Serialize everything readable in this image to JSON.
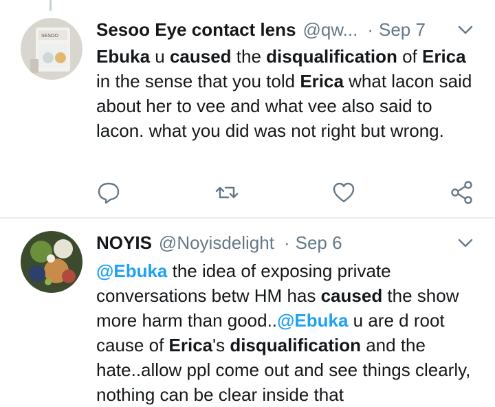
{
  "tweets": [
    {
      "name": "Sesoo Eye contact lens",
      "handle": "@qw...",
      "separator": "·",
      "date": "Sep 7",
      "body": {
        "t1": "Ebuka",
        "t2": " u ",
        "t3": "caused",
        "t4": " the ",
        "t5": "disqualification",
        "t6": " of ",
        "t7": "Erica",
        "t8": " in the sense that you told ",
        "t9": "Erica",
        "t10": " what lacon said about her to vee and what vee also said to lacon. what you did was not right but wrong."
      },
      "actions": [
        "reply-icon",
        "retweet-icon",
        "like-icon",
        "share-icon"
      ]
    },
    {
      "name": "NOYIS",
      "handle": "@Noyisdelight",
      "separator": "·",
      "date": "Sep 6",
      "body": {
        "t1": "@Ebuka",
        "t2": " the idea of exposing private conversations betw HM has ",
        "t3": "caused",
        "t4": " the show more harm than good..",
        "t5": "@Ebuka",
        "t6": " u are d root cause of ",
        "t7": "Erica",
        "t8": "'s ",
        "t9": "disqualification",
        "t10": " and the hate..allow ppl come out and see things clearly, nothing can be clear inside that"
      }
    }
  ],
  "colors": {
    "text": "#14171a",
    "secondary": "#657786",
    "mention": "#1da1f2",
    "divider": "#e6ecf0"
  }
}
